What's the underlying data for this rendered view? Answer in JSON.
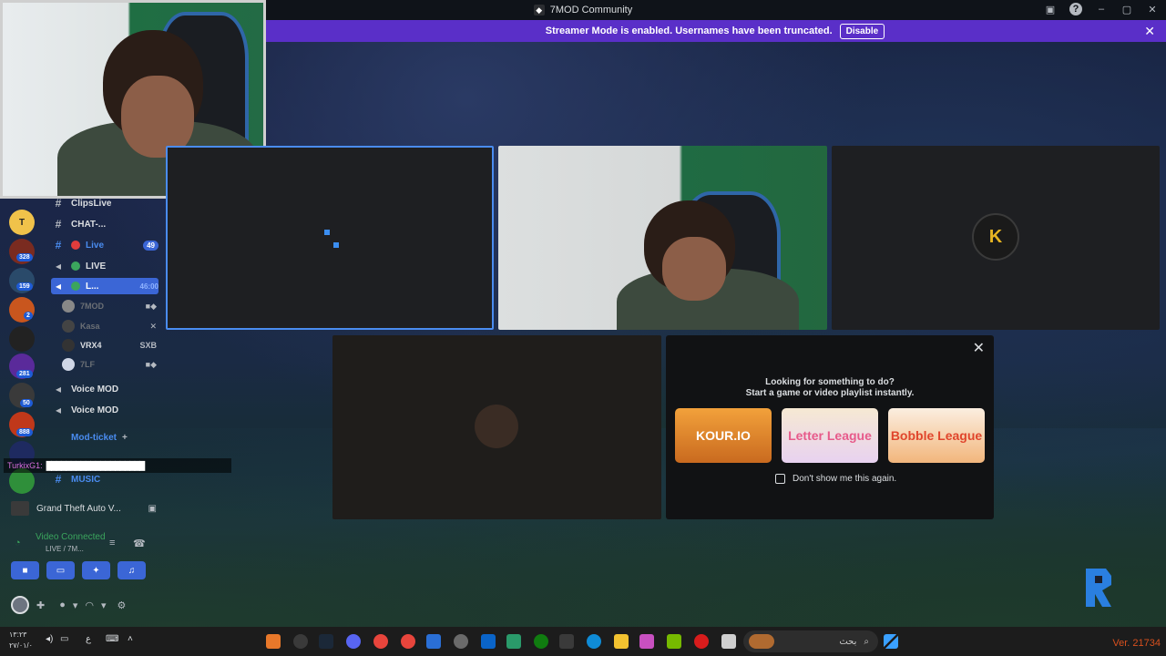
{
  "window": {
    "title": "7MOD Community"
  },
  "banner": {
    "text": "Streamer Mode is enabled. Usernames have been truncated.",
    "button": "Disable",
    "close": "✕"
  },
  "servers": {
    "badges": [
      "328",
      "159",
      "2",
      "281",
      "50",
      "888"
    ]
  },
  "channels": {
    "items": [
      {
        "label": "ClipsLive"
      },
      {
        "label": "CHAT-..."
      },
      {
        "label": "Live",
        "count": "49"
      },
      {
        "label": "LIVE"
      },
      {
        "label": "L...",
        "time": "46:00"
      },
      {
        "label": "Voice MOD"
      },
      {
        "label": "Voice MOD"
      },
      {
        "label": "Mod-ticket"
      },
      {
        "label": "MUSIC"
      }
    ],
    "voice_users": [
      {
        "name": "7MOD"
      },
      {
        "name": "Kasa"
      },
      {
        "name": "VRX4",
        "tail": "SXB"
      },
      {
        "name": "7LF"
      }
    ]
  },
  "chat_overlay": {
    "nick": "TurkixG1:",
    "message": "████████████████████"
  },
  "activity_row": {
    "game": "Grand Theft Auto V..."
  },
  "voice_panel": {
    "status": "Video Connected",
    "sub": "LIVE / 7M..."
  },
  "activity_panel": {
    "line1": "Looking for something to do?",
    "line2": "Start a game or video playlist instantly.",
    "cards": [
      "KOUR.IO",
      "Letter League",
      "Bobble League"
    ],
    "checkbox": "Don't show me this again."
  },
  "tiles": {
    "avatar_letter": "K"
  },
  "taskbar": {
    "clock": "١٣:٢٣",
    "date": "٢٧/٠١/٠",
    "search_text": "بحث",
    "lang": "ع"
  },
  "version": "Ver. 21734"
}
